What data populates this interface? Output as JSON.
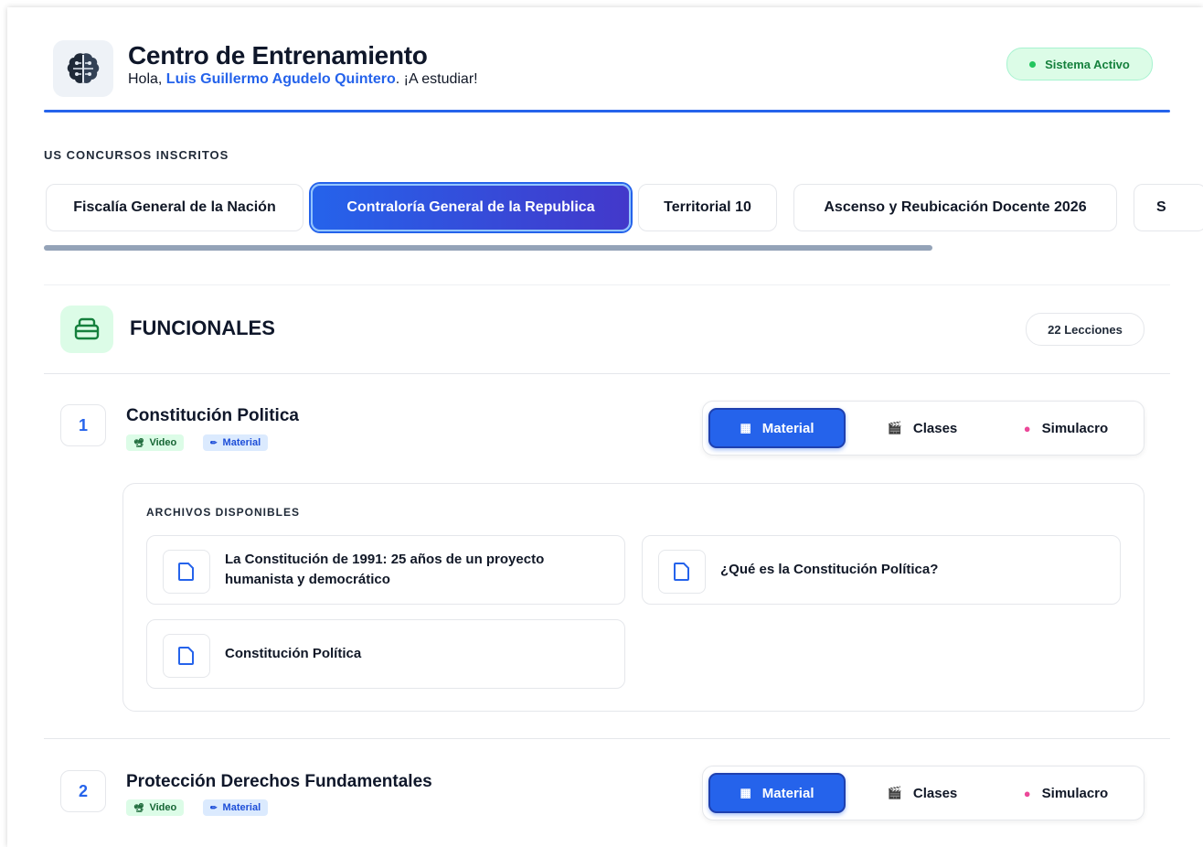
{
  "header": {
    "title": "Centro de Entrenamiento",
    "greeting_prefix": "Hola, ",
    "user_name": "Luis Guillermo Agudelo Quintero",
    "greeting_suffix": ". ¡A estudiar!",
    "status": "Sistema Activo"
  },
  "contests": {
    "label": "US CONCURSOS INSCRITOS",
    "tabs": [
      {
        "label": "Fiscalía General de la Nación"
      },
      {
        "label": "Contraloría General de la Republica",
        "active": true
      },
      {
        "label": "Territorial 10"
      },
      {
        "label": "Ascenso y Reubicación Docente 2026"
      },
      {
        "label": "S"
      }
    ]
  },
  "module": {
    "title": "FUNCIONALES",
    "lessons_count": "22 Lecciones"
  },
  "lessons": [
    {
      "number": "1",
      "title": "Constitución Politica",
      "badges": {
        "video": "Video",
        "material": "Material"
      },
      "actions": {
        "material": "Material",
        "clases": "Clases",
        "simulacro": "Simulacro"
      },
      "files_label": "ARCHIVOS DISPONIBLES",
      "files": [
        {
          "name": "La Constitución de 1991: 25 años de un proyecto humanista y democrático"
        },
        {
          "name": "¿Qué es la Constitución Política?"
        },
        {
          "name": "Constitución Política"
        }
      ]
    },
    {
      "number": "2",
      "title": "Protección Derechos Fundamentales",
      "badges": {
        "video": "Video",
        "material": "Material"
      },
      "actions": {
        "material": "Material",
        "clases": "Clases",
        "simulacro": "Simulacro"
      }
    }
  ],
  "colors": {
    "accent": "#2563eb",
    "success": "#22c55e",
    "success_bg": "#dcfce7"
  },
  "icons": {
    "logo": "brain-chip-icon",
    "module": "layers-icon",
    "file": "document-icon",
    "video": "video-camera-icon",
    "material": "pencil-icon",
    "clases": "clapperboard-icon",
    "simulacro": "brain-icon"
  }
}
